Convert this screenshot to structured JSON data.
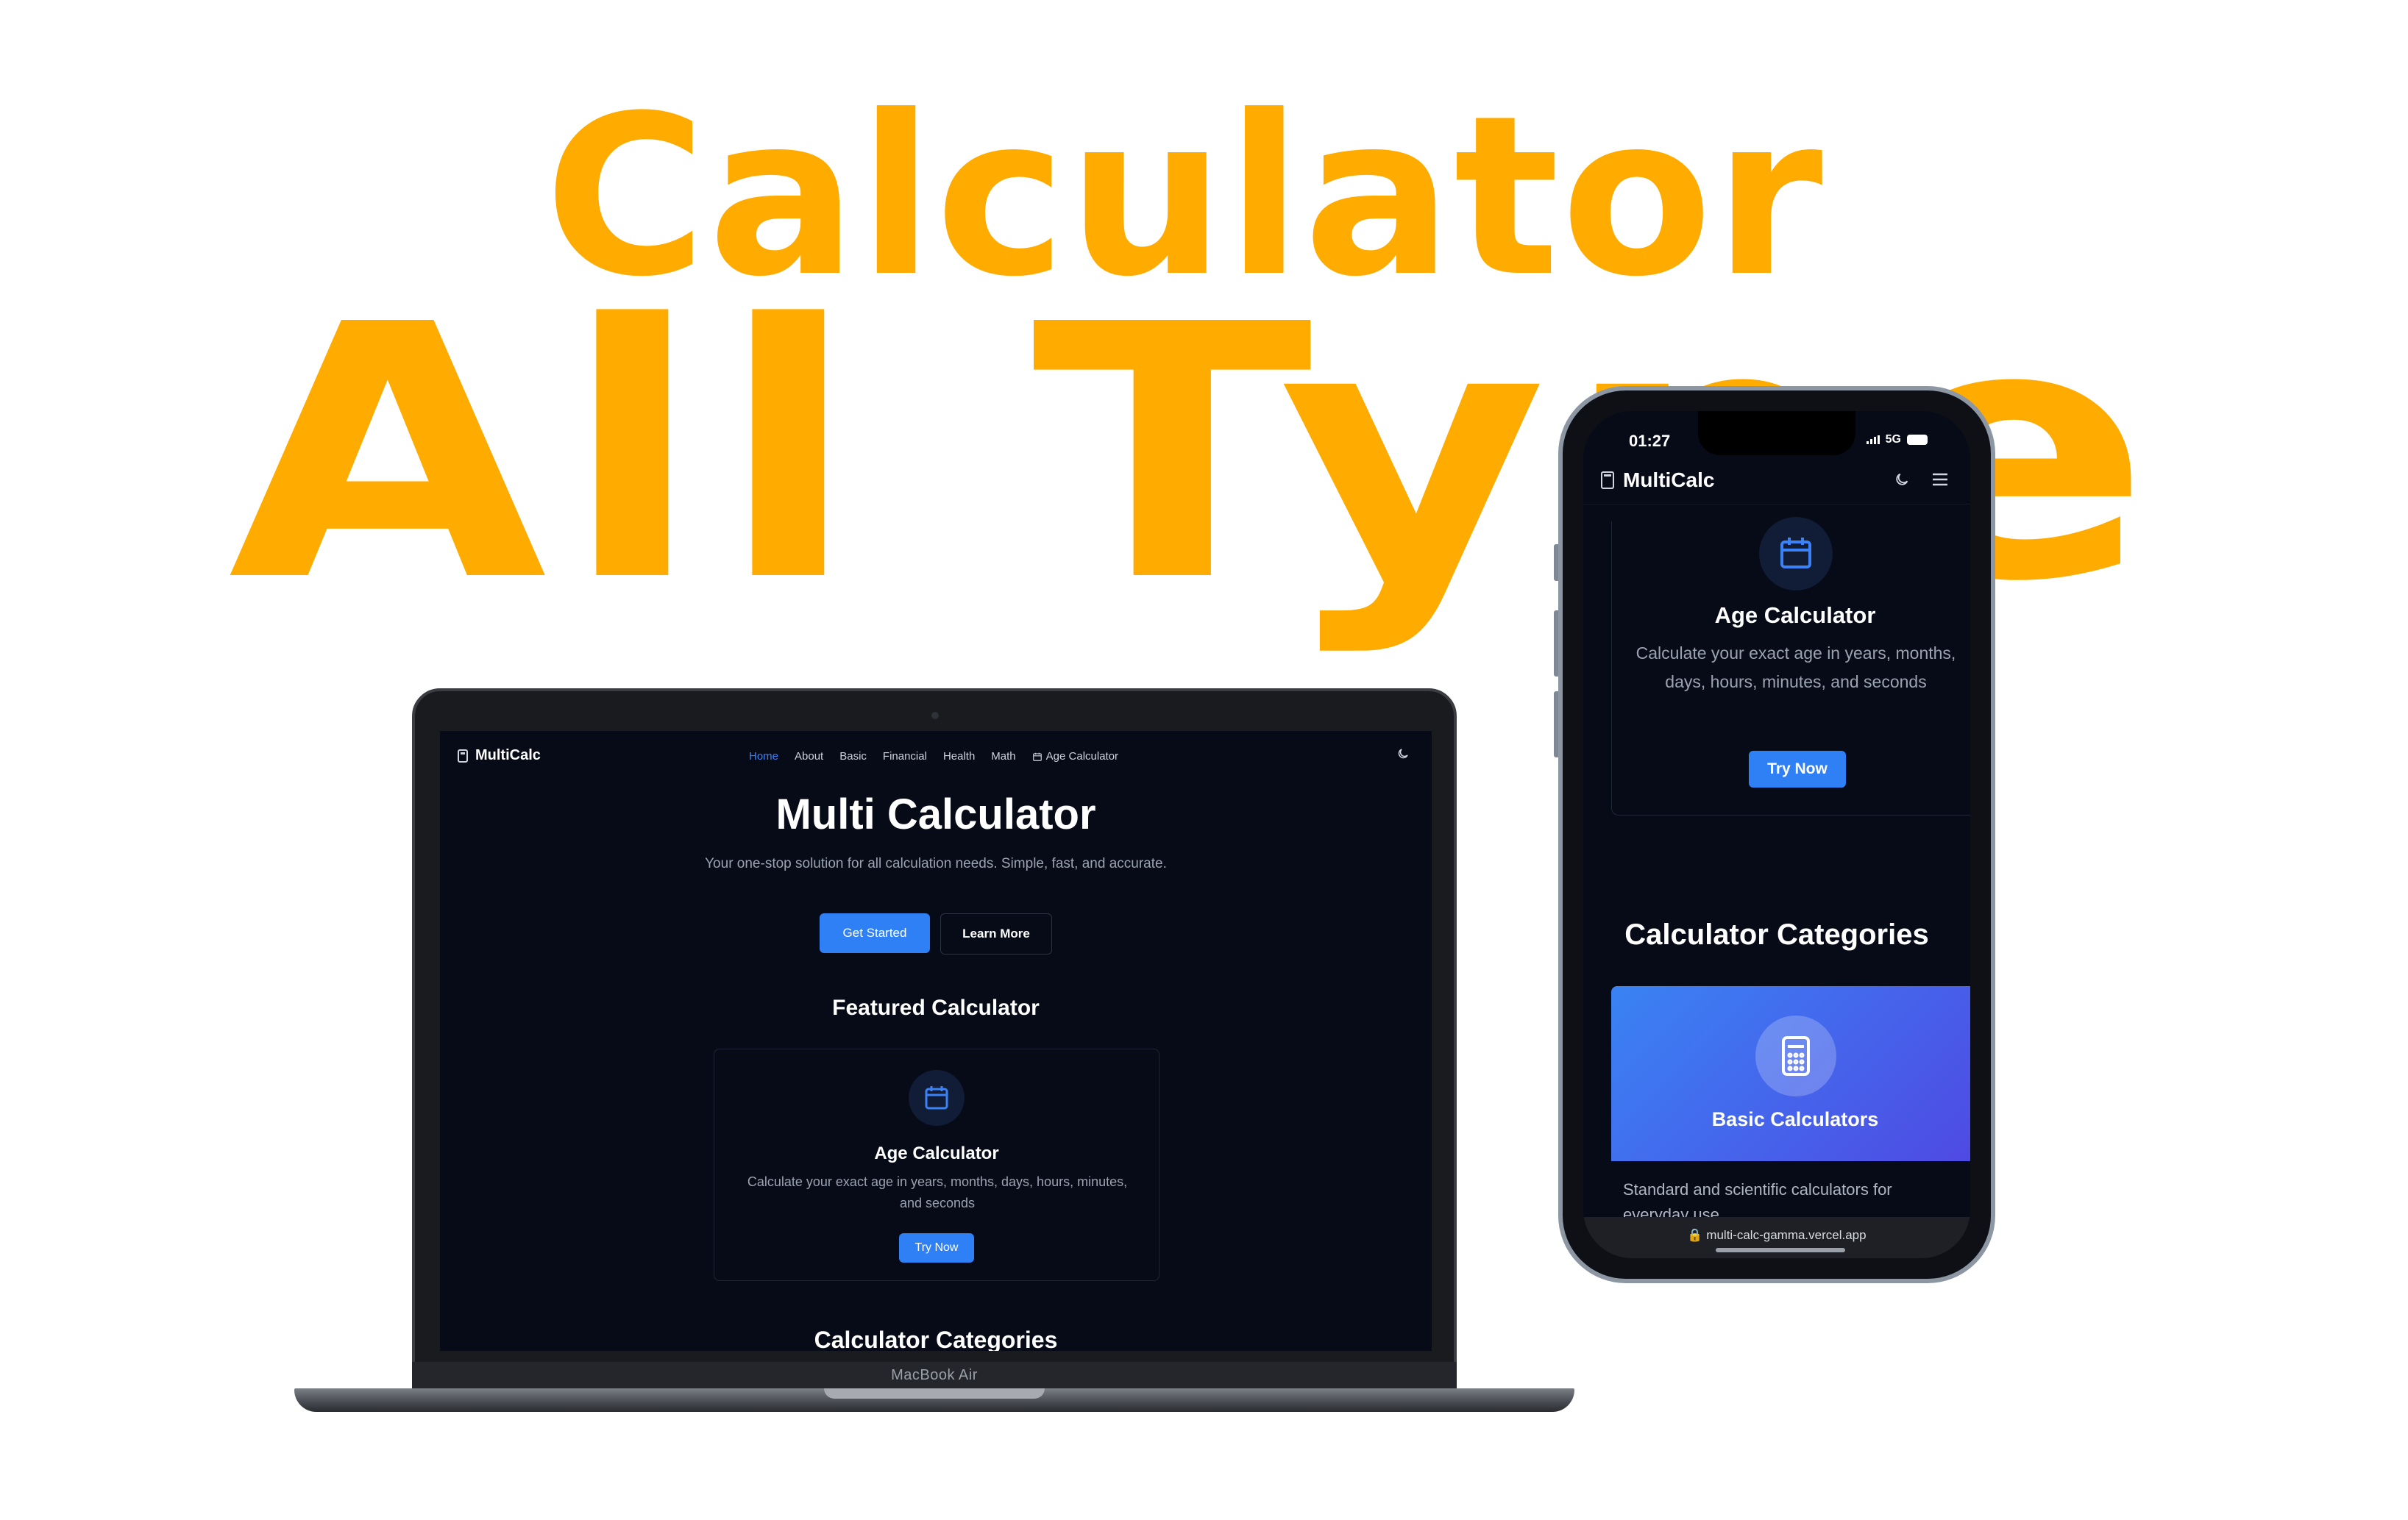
{
  "headline": {
    "line1": "Calculator",
    "line2": "All Type"
  },
  "laptop": {
    "model_label": "MacBook Air",
    "site": {
      "logo": "MultiCalc",
      "nav": [
        "Home",
        "About",
        "Basic",
        "Financial",
        "Health",
        "Math",
        "Age Calculator"
      ],
      "active_nav": "Home",
      "hero_title": "Multi Calculator",
      "hero_subtitle": "Your one-stop solution for all calculation needs. Simple, fast, and accurate.",
      "get_started": "Get Started",
      "learn_more": "Learn More",
      "featured_heading": "Featured Calculator",
      "featured_card": {
        "title": "Age Calculator",
        "description": "Calculate your exact age in years, months, days, hours, minutes, and seconds",
        "button": "Try Now"
      },
      "categories_heading": "Calculator Categories"
    }
  },
  "phone": {
    "time": "01:27",
    "network": "5G",
    "site": {
      "logo": "MultiCalc",
      "card": {
        "title": "Age Calculator",
        "description": "Calculate your exact age in years, months, days, hours, minutes, and seconds",
        "button": "Try Now"
      },
      "categories_heading": "Calculator Categories",
      "basic_card": {
        "title": "Basic Calculators",
        "description": "Standard and scientific calculators for everyday use"
      },
      "url": "multi-calc-gamma.vercel.app"
    }
  },
  "colors": {
    "headline": "#ffab00",
    "accent": "#2f7ff5",
    "screen_bg": "#070b17"
  }
}
